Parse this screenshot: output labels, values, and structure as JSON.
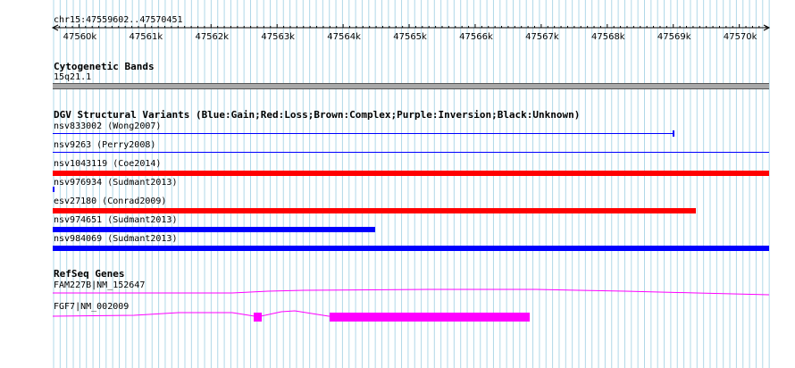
{
  "ruler": {
    "location": "chr15:47559602..47570451",
    "ticks": [
      "47560k",
      "47561k",
      "47562k",
      "47563k",
      "47564k",
      "47565k",
      "47566k",
      "47567k",
      "47568k",
      "47569k",
      "47570k"
    ]
  },
  "cytoband": {
    "title": "Cytogenetic Bands",
    "band_label": "15q21.1"
  },
  "dgv": {
    "title": "DGV Structural Variants (Blue:Gain;Red:Loss;Brown:Complex;Purple:Inversion;Black:Unknown)",
    "features": [
      {
        "label": "nsv833002 (Wong2007)",
        "type": "gain",
        "style": "thin",
        "start": 47559602,
        "end": 47569000,
        "end_cap": true
      },
      {
        "label": "nsv9263 (Perry2008)",
        "type": "gain",
        "style": "thin",
        "start": 47559602,
        "end": 47570451
      },
      {
        "label": "nsv1043119 (Coe2014)",
        "type": "loss",
        "style": "thick",
        "start": 47559602,
        "end": 47570451
      },
      {
        "label": "nsv976934 (Sudmant2013)",
        "type": "gain",
        "style": "dot",
        "start": 47559602,
        "end": 47559625
      },
      {
        "label": "esv27180 (Conrad2009)",
        "type": "loss",
        "style": "thick",
        "start": 47559602,
        "end": 47569340
      },
      {
        "label": "nsv974651 (Sudmant2013)",
        "type": "gain",
        "style": "thick",
        "start": 47559602,
        "end": 47564490
      },
      {
        "label": "nsv984069 (Sudmant2013)",
        "type": "gain",
        "style": "thick",
        "start": 47559602,
        "end": 47570451
      }
    ]
  },
  "refseq": {
    "title": "RefSeq Genes",
    "genes": [
      {
        "label": "FAM227B|NM_152647"
      },
      {
        "label": "FGF7|NM_002009"
      }
    ]
  },
  "colors": {
    "gain": "#0000ff",
    "loss": "#ff0000",
    "gene": "#ff00ff",
    "grid": "#b0d8e8",
    "band": "#a9a9a9"
  }
}
